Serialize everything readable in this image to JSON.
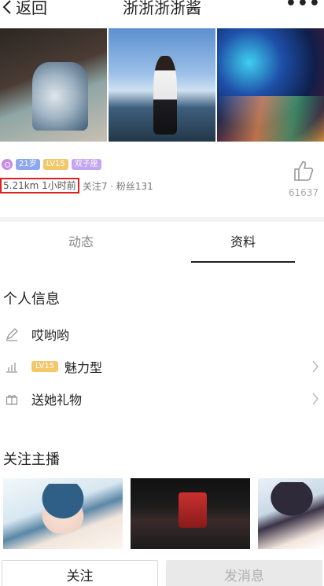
{
  "header": {
    "back_label": "返回",
    "title": "浙浙浙浙酱",
    "more_label": "•••"
  },
  "photos": [
    "photo-1",
    "photo-2",
    "photo-3"
  ],
  "profile": {
    "badges": {
      "age": "21岁",
      "level": "LV15",
      "zodiac": "双子座"
    },
    "distance_time": "5.21km 1小时前",
    "follow_info": "关注7 · 粉丝131",
    "like_count": "61637"
  },
  "tabs": [
    {
      "label": "动态",
      "active": false
    },
    {
      "label": "资料",
      "active": true
    }
  ],
  "personal_info": {
    "title": "个人信息",
    "signature": "哎哟哟",
    "charm_level": "LV15",
    "charm_type": "魅力型",
    "gift_label": "送她礼物"
  },
  "followed_anchors": {
    "title": "关注主播"
  },
  "actions": {
    "follow": "关注",
    "message": "发消息"
  },
  "colors": {
    "highlight_border": "#e02020",
    "age_badge": "#8ea8f0",
    "level_badge": "#f4c86a",
    "zodiac_badge": "#c3a5f2"
  }
}
